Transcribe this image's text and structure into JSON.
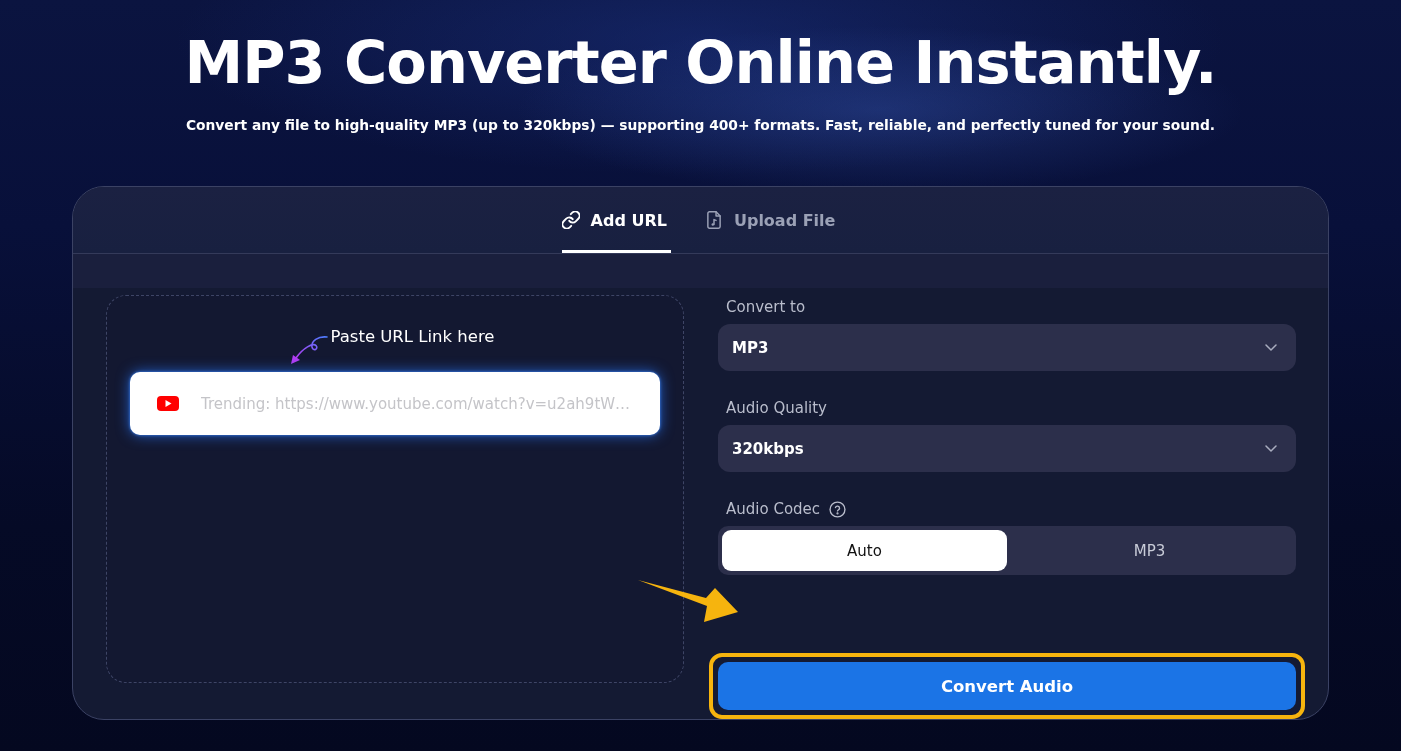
{
  "hero": {
    "title": "MP3 Converter Online Instantly.",
    "subtitle": "Convert any file to high-quality MP3 (up to 320kbps) — supporting 400+ formats. Fast, reliable, and perfectly tuned for your sound."
  },
  "tabs": [
    {
      "kind": "url",
      "label": "Add URL",
      "selected": true
    },
    {
      "kind": "upload",
      "label": "Upload File",
      "selected": false
    }
  ],
  "url_panel": {
    "hint": "Paste URL Link here",
    "input": {
      "placeholder": "Trending: https://www.youtube.com/watch?v=u2ah9tW…"
    }
  },
  "settings": [
    {
      "kind": "select",
      "label": "Convert to",
      "help": false,
      "value": "MP3"
    },
    {
      "kind": "select",
      "label": "Audio Quality",
      "help": false,
      "value": "320kbps"
    },
    {
      "kind": "segmented",
      "label": "Audio Codec",
      "help": true,
      "options": [
        {
          "label": "Auto",
          "selected": true
        },
        {
          "label": "MP3",
          "selected": false
        }
      ]
    }
  ],
  "convert_button": {
    "label": "Convert Audio",
    "highlighted": true
  }
}
